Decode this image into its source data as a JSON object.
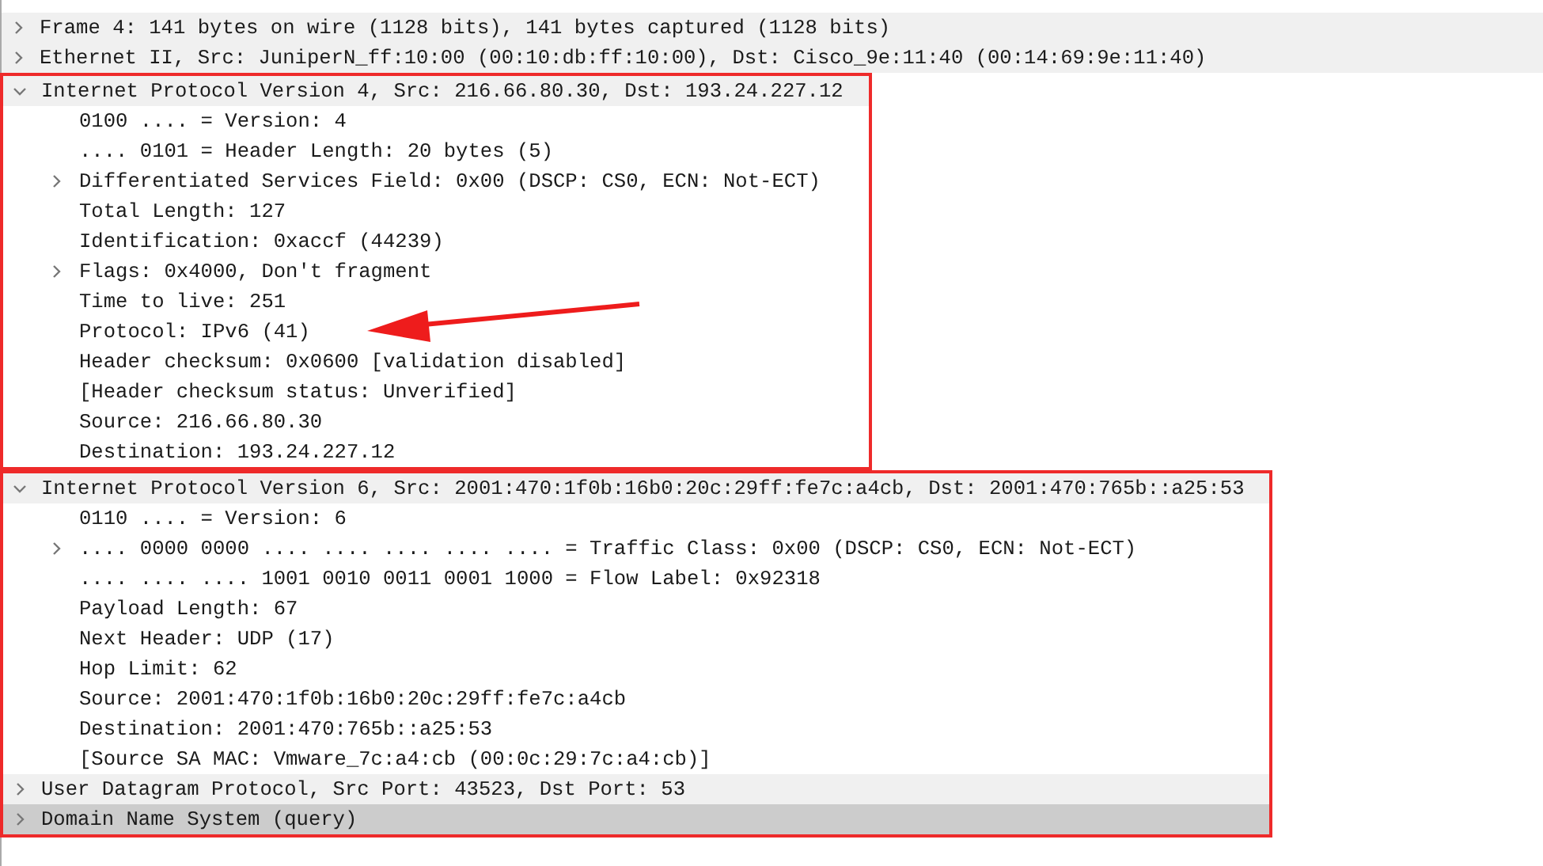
{
  "tree": [
    {
      "label": "Frame 4: 141 bytes on wire (1128 bits), 141 bytes captured (1128 bits)",
      "kind": "branch",
      "expanded": false,
      "selected": false,
      "highlighted": false
    },
    {
      "label": "Ethernet II, Src: JuniperN_ff:10:00 (00:10:db:ff:10:00), Dst: Cisco_9e:11:40 (00:14:69:9e:11:40)",
      "kind": "branch",
      "expanded": false,
      "selected": false,
      "highlighted": false
    },
    {
      "label": "Internet Protocol Version 4, Src: 216.66.80.30, Dst: 193.24.227.12",
      "kind": "branch",
      "expanded": true,
      "selected": false,
      "highlighted": true,
      "children": [
        {
          "label": "0100 .... = Version: 4",
          "kind": "leaf",
          "selected": false,
          "pointed": false
        },
        {
          "label": ".... 0101 = Header Length: 20 bytes (5)",
          "kind": "leaf",
          "selected": false,
          "pointed": false
        },
        {
          "label": "Differentiated Services Field: 0x00 (DSCP: CS0, ECN: Not-ECT)",
          "kind": "branch",
          "expanded": false,
          "selected": false,
          "pointed": false
        },
        {
          "label": "Total Length: 127",
          "kind": "leaf",
          "selected": false,
          "pointed": false
        },
        {
          "label": "Identification: 0xaccf (44239)",
          "kind": "leaf",
          "selected": false,
          "pointed": false
        },
        {
          "label": "Flags: 0x4000, Don't fragment",
          "kind": "branch",
          "expanded": false,
          "selected": false,
          "pointed": false
        },
        {
          "label": "Time to live: 251",
          "kind": "leaf",
          "selected": false,
          "pointed": false
        },
        {
          "label": "Protocol: IPv6 (41)",
          "kind": "leaf",
          "selected": false,
          "pointed": true
        },
        {
          "label": "Header checksum: 0x0600 [validation disabled]",
          "kind": "leaf",
          "selected": false,
          "pointed": false
        },
        {
          "label": "[Header checksum status: Unverified]",
          "kind": "leaf",
          "selected": false,
          "pointed": false
        },
        {
          "label": "Source: 216.66.80.30",
          "kind": "leaf",
          "selected": false,
          "pointed": false
        },
        {
          "label": "Destination: 193.24.227.12",
          "kind": "leaf",
          "selected": false,
          "pointed": false
        }
      ]
    },
    {
      "label": "Internet Protocol Version 6, Src: 2001:470:1f0b:16b0:20c:29ff:fe7c:a4cb, Dst: 2001:470:765b::a25:53",
      "kind": "branch",
      "expanded": true,
      "selected": false,
      "highlighted": true,
      "children": [
        {
          "label": "0110 .... = Version: 6",
          "kind": "leaf",
          "selected": false,
          "pointed": false
        },
        {
          "label": ".... 0000 0000 .... .... .... .... .... = Traffic Class: 0x00 (DSCP: CS0, ECN: Not-ECT)",
          "kind": "branch",
          "expanded": false,
          "selected": false,
          "pointed": false
        },
        {
          "label": ".... .... .... 1001 0010 0011 0001 1000 = Flow Label: 0x92318",
          "kind": "leaf",
          "selected": false,
          "pointed": false
        },
        {
          "label": "Payload Length: 67",
          "kind": "leaf",
          "selected": false,
          "pointed": false
        },
        {
          "label": "Next Header: UDP (17)",
          "kind": "leaf",
          "selected": false,
          "pointed": false
        },
        {
          "label": "Hop Limit: 62",
          "kind": "leaf",
          "selected": false,
          "pointed": false
        },
        {
          "label": "Source: 2001:470:1f0b:16b0:20c:29ff:fe7c:a4cb",
          "kind": "leaf",
          "selected": false,
          "pointed": false
        },
        {
          "label": "Destination: 2001:470:765b::a25:53",
          "kind": "leaf",
          "selected": false,
          "pointed": false
        },
        {
          "label": "[Source SA MAC: Vmware_7c:a4:cb (00:0c:29:7c:a4:cb)]",
          "kind": "leaf",
          "selected": false,
          "pointed": false
        }
      ]
    },
    {
      "label": "User Datagram Protocol, Src Port: 43523, Dst Port: 53",
      "kind": "branch",
      "expanded": false,
      "selected": false,
      "highlighted": true,
      "joins_previous": true
    },
    {
      "label": "Domain Name System (query)",
      "kind": "branch",
      "expanded": false,
      "selected": true,
      "highlighted": true,
      "joins_previous": true
    }
  ]
}
